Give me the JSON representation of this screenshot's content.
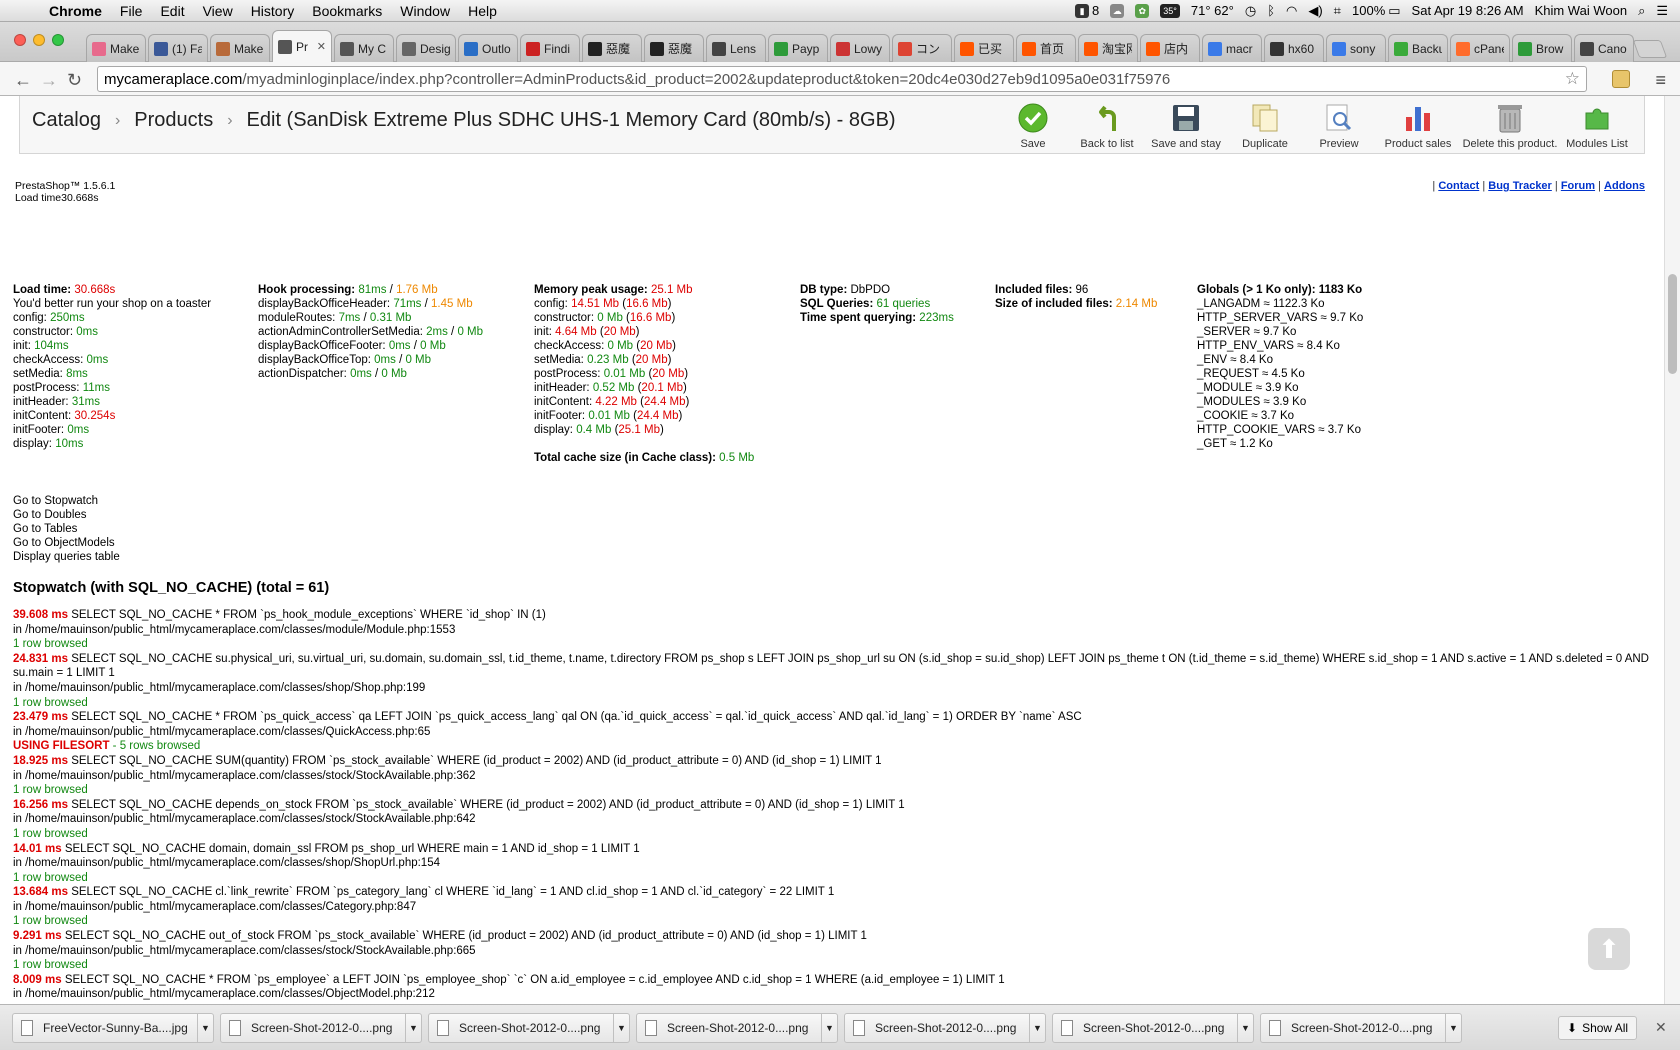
{
  "menubar": {
    "app": "Chrome",
    "items": [
      "File",
      "Edit",
      "View",
      "History",
      "Bookmarks",
      "Window",
      "Help"
    ],
    "status": {
      "count": "8",
      "temp_badge": "35°",
      "temps": "71° 62°",
      "battery": "100%",
      "datetime": "Sat Apr 19  8:26 AM",
      "user": "Khim Wai Woon"
    }
  },
  "tabs": [
    {
      "label": "Make",
      "icon": "heart-icon",
      "color": "#e76a8c"
    },
    {
      "label": "(1) Fa",
      "icon": "facebook-icon",
      "color": "#3b5998"
    },
    {
      "label": "Make",
      "icon": "boat-icon",
      "color": "#b86a3a"
    },
    {
      "label": "Pr",
      "icon": "camera-icon",
      "color": "#555555",
      "active": true
    },
    {
      "label": "My C",
      "icon": "camera-icon",
      "color": "#555555"
    },
    {
      "label": "Desig",
      "icon": "u-icon",
      "color": "#666666"
    },
    {
      "label": "Outlo",
      "icon": "outlook-icon",
      "color": "#2a6ec6"
    },
    {
      "label": "Findi",
      "icon": "f-icon",
      "color": "#cc2222"
    },
    {
      "label": "惡魔",
      "icon": "taobao-icon",
      "color": "#222222"
    },
    {
      "label": "惡魔",
      "icon": "taobao-icon",
      "color": "#222222"
    },
    {
      "label": "Lens",
      "icon": "m-icon",
      "color": "#444444"
    },
    {
      "label": "Payp",
      "icon": "paypal-icon",
      "color": "#2e9b3a"
    },
    {
      "label": "Lowy",
      "icon": "lowy-icon",
      "color": "#cc3333"
    },
    {
      "label": "コン",
      "icon": "c-icon",
      "color": "#dd4433"
    },
    {
      "label": "已买",
      "icon": "tao-icon",
      "color": "#ff5500"
    },
    {
      "label": "首页",
      "icon": "tao-icon",
      "color": "#ff5500"
    },
    {
      "label": "淘宝网",
      "icon": "tao-icon",
      "color": "#ff5500"
    },
    {
      "label": "店内",
      "icon": "tao-icon",
      "color": "#ff5500"
    },
    {
      "label": "macr",
      "icon": "google-icon",
      "color": "#3a7ae8"
    },
    {
      "label": "hx60",
      "icon": "bh-icon",
      "color": "#333333"
    },
    {
      "label": "sony",
      "icon": "google-icon",
      "color": "#3a7ae8"
    },
    {
      "label": "Backu",
      "icon": "leaf-icon",
      "color": "#3aaa3a"
    },
    {
      "label": "cPane",
      "icon": "cpanel-icon",
      "color": "#ff6c2c"
    },
    {
      "label": "Brow",
      "icon": "brow-icon",
      "color": "#2e9b3a"
    },
    {
      "label": "Cano",
      "icon": "m-icon",
      "color": "#444444"
    }
  ],
  "address": {
    "domain": "mycameraplace.com",
    "path": "/myadminloginplace/index.php?controller=AdminProducts&id_product=2002&updateproduct&token=20dc4e030d27eb9d1095a0e031f75976"
  },
  "breadcrumb": {
    "catalog": "Catalog",
    "products": "Products",
    "title": "Edit (SanDisk Extreme Plus SDHC UHS-1 Memory Card (80mb/s) - 8GB)"
  },
  "toolbar": {
    "save": "Save",
    "back": "Back to list",
    "save_stay": "Save and stay",
    "duplicate": "Duplicate",
    "preview": "Preview",
    "sales": "Product sales",
    "delete": "Delete this product.",
    "modules": "Modules List"
  },
  "footer_info": {
    "version": "PrestaShop™ 1.5.6.1",
    "load": "Load time30.668s"
  },
  "footer_links": {
    "contact": "Contact",
    "bug": "Bug Tracker",
    "forum": "Forum",
    "addons": "Addons"
  },
  "debug": {
    "col1": {
      "load_label": "Load time:",
      "load_val": "30.668s",
      "toaster": "You'd better run your shop on a toaster",
      "rows": [
        {
          "k": "config:",
          "v": "250ms",
          "c": "g"
        },
        {
          "k": "constructor:",
          "v": "0ms",
          "c": "g"
        },
        {
          "k": "init:",
          "v": "104ms",
          "c": "g"
        },
        {
          "k": "checkAccess:",
          "v": "0ms",
          "c": "g"
        },
        {
          "k": "setMedia:",
          "v": "8ms",
          "c": "g"
        },
        {
          "k": "postProcess:",
          "v": "11ms",
          "c": "g"
        },
        {
          "k": "initHeader:",
          "v": "31ms",
          "c": "g"
        },
        {
          "k": "initContent:",
          "v": "30.254s",
          "c": "r"
        },
        {
          "k": "initFooter:",
          "v": "0ms",
          "c": "g"
        },
        {
          "k": "display:",
          "v": "10ms",
          "c": "g"
        }
      ]
    },
    "col2": {
      "label": "Hook processing:",
      "v1": "81ms",
      "sep": " / ",
      "v2": "1.76 Mb",
      "rows": [
        {
          "k": "displayBackOfficeHeader:",
          "v1": "71ms",
          "c1": "g",
          "v2": "1.45 Mb",
          "c2": "o"
        },
        {
          "k": "moduleRoutes:",
          "v1": "7ms",
          "c1": "g",
          "v2": "0.31 Mb",
          "c2": "g"
        },
        {
          "k": "actionAdminControllerSetMedia:",
          "v1": "2ms",
          "c1": "g",
          "v2": "0 Mb",
          "c2": "g"
        },
        {
          "k": "displayBackOfficeFooter:",
          "v1": "0ms",
          "c1": "g",
          "v2": "0 Mb",
          "c2": "g"
        },
        {
          "k": "displayBackOfficeTop:",
          "v1": "0ms",
          "c1": "g",
          "v2": "0 Mb",
          "c2": "g"
        },
        {
          "k": "actionDispatcher:",
          "v1": "0ms",
          "c1": "g",
          "v2": "0 Mb",
          "c2": "g"
        }
      ]
    },
    "col3": {
      "label": "Memory peak usage:",
      "val": "25.1 Mb",
      "rows": [
        {
          "k": "config:",
          "a": "14.51 Mb",
          "ca": "r",
          "b": "16.6 Mb",
          "cb": "r"
        },
        {
          "k": "constructor:",
          "a": "0 Mb",
          "ca": "g",
          "b": "16.6 Mb",
          "cb": "r"
        },
        {
          "k": "init:",
          "a": "4.64 Mb",
          "ca": "r",
          "b": "20 Mb",
          "cb": "r"
        },
        {
          "k": "checkAccess:",
          "a": "0 Mb",
          "ca": "g",
          "b": "20 Mb",
          "cb": "r"
        },
        {
          "k": "setMedia:",
          "a": "0.23 Mb",
          "ca": "g",
          "b": "20 Mb",
          "cb": "r"
        },
        {
          "k": "postProcess:",
          "a": "0.01 Mb",
          "ca": "g",
          "b": "20 Mb",
          "cb": "r"
        },
        {
          "k": "initHeader:",
          "a": "0.52 Mb",
          "ca": "g",
          "b": "20.1 Mb",
          "cb": "r"
        },
        {
          "k": "initContent:",
          "a": "4.22 Mb",
          "ca": "r",
          "b": "24.4 Mb",
          "cb": "r"
        },
        {
          "k": "initFooter:",
          "a": "0.01 Mb",
          "ca": "g",
          "b": "24.4 Mb",
          "cb": "r"
        },
        {
          "k": "display:",
          "a": "0.4 Mb",
          "ca": "g",
          "b": "25.1 Mb",
          "cb": "r"
        }
      ],
      "cache_label": "Total cache size (in Cache class):",
      "cache_val": "0.5 Mb"
    },
    "col4": {
      "db_label": "DB type:",
      "db_val": "DbPDO",
      "sql_label": "SQL Queries:",
      "sql_val": "61 queries",
      "time_label": "Time spent querying:",
      "time_val": "223ms"
    },
    "col5": {
      "inc_label": "Included files:",
      "inc_val": "96",
      "size_label": "Size of included files:",
      "size_val": "2.14 Mb"
    },
    "col6": {
      "label": "Globals (> 1 Ko only): 1183 Ko",
      "rows": [
        "_LANGADM ≈ 1122.3 Ko",
        "HTTP_SERVER_VARS ≈ 9.7 Ko",
        "_SERVER ≈ 9.7 Ko",
        "HTTP_ENV_VARS ≈ 8.4 Ko",
        "_ENV ≈ 8.4 Ko",
        "_REQUEST ≈ 4.5 Ko",
        "_MODULE ≈ 3.9 Ko",
        "_MODULES ≈ 3.9 Ko",
        "_COOKIE ≈ 3.7 Ko",
        "HTTP_COOKIE_VARS ≈ 3.7 Ko",
        "_GET ≈ 1.2 Ko"
      ]
    },
    "goto": [
      "Go to Stopwatch",
      "Go to Doubles",
      "Go to Tables",
      "Go to ObjectModels",
      "Display queries table"
    ],
    "stopwatch_title": "Stopwatch (with SQL_NO_CACHE) (total = 61)",
    "queries": [
      {
        "time": "39.608 ms",
        "sql": "SELECT SQL_NO_CACHE * FROM `ps_hook_module_exceptions` WHERE `id_shop` IN (1)",
        "file": "in /home/mauinson/public_html/mycameraplace.com/classes/module/Module.php:1553",
        "rows": "1 row browsed"
      },
      {
        "time": "24.831 ms",
        "sql": "SELECT SQL_NO_CACHE su.physical_uri, su.virtual_uri, su.domain, su.domain_ssl, t.id_theme, t.name, t.directory FROM ps_shop s LEFT JOIN ps_shop_url su ON (s.id_shop = su.id_shop) LEFT JOIN ps_theme t ON (t.id_theme = s.id_theme) WHERE s.id_shop = 1 AND s.active = 1 AND s.deleted = 0 AND su.main = 1 LIMIT 1",
        "file": "in /home/mauinson/public_html/mycameraplace.com/classes/shop/Shop.php:199",
        "rows": "1 row browsed"
      },
      {
        "time": "23.479 ms",
        "sql": "SELECT SQL_NO_CACHE * FROM `ps_quick_access` qa LEFT JOIN `ps_quick_access_lang` qal ON (qa.`id_quick_access` = qal.`id_quick_access` AND qal.`id_lang` = 1) ORDER BY `name` ASC",
        "file": "in /home/mauinson/public_html/mycameraplace.com/classes/QuickAccess.php:65",
        "filesort": "USING FILESORT",
        "rows": " - 5 rows browsed"
      },
      {
        "time": "18.925 ms",
        "sql": "SELECT SQL_NO_CACHE SUM(quantity) FROM `ps_stock_available` WHERE (id_product = 2002) AND (id_product_attribute = 0) AND (id_shop = 1) LIMIT 1",
        "file": "in /home/mauinson/public_html/mycameraplace.com/classes/stock/StockAvailable.php:362",
        "rows": "1 row browsed"
      },
      {
        "time": "16.256 ms",
        "sql": "SELECT SQL_NO_CACHE depends_on_stock FROM `ps_stock_available` WHERE (id_product = 2002) AND (id_product_attribute = 0) AND (id_shop = 1) LIMIT 1",
        "file": "in /home/mauinson/public_html/mycameraplace.com/classes/stock/StockAvailable.php:642",
        "rows": "1 row browsed"
      },
      {
        "time": "14.01 ms",
        "sql": "SELECT SQL_NO_CACHE domain, domain_ssl FROM ps_shop_url WHERE main = 1 AND id_shop = 1 LIMIT 1",
        "file": "in /home/mauinson/public_html/mycameraplace.com/classes/shop/ShopUrl.php:154",
        "rows": "1 row browsed"
      },
      {
        "time": "13.684 ms",
        "sql": "SELECT SQL_NO_CACHE cl.`link_rewrite` FROM `ps_category_lang` cl WHERE `id_lang` = 1 AND cl.id_shop = 1 AND cl.`id_category` = 22 LIMIT 1",
        "file": "in /home/mauinson/public_html/mycameraplace.com/classes/Category.php:847",
        "rows": "1 row browsed"
      },
      {
        "time": "9.291 ms",
        "sql": "SELECT SQL_NO_CACHE out_of_stock FROM `ps_stock_available` WHERE (id_product = 2002) AND (id_product_attribute = 0) AND (id_shop = 1) LIMIT 1",
        "file": "in /home/mauinson/public_html/mycameraplace.com/classes/stock/StockAvailable.php:665",
        "rows": "1 row browsed"
      },
      {
        "time": "8.009 ms",
        "sql": "SELECT SQL_NO_CACHE * FROM `ps_employee` a LEFT JOIN `ps_employee_shop` `c` ON a.id_employee = c.id_employee AND c.id_shop = 1 WHERE (a.id_employee = 1) LIMIT 1",
        "file": "in /home/mauinson/public_html/mycameraplace.com/classes/ObjectModel.php:212",
        "rows": ""
      }
    ]
  },
  "downloads": [
    "FreeVector-Sunny-Ba....jpg",
    "Screen-Shot-2012-0....png",
    "Screen-Shot-2012-0....png",
    "Screen-Shot-2012-0....png",
    "Screen-Shot-2012-0....png",
    "Screen-Shot-2012-0....png",
    "Screen-Shot-2012-0....png"
  ],
  "show_all": "Show All"
}
